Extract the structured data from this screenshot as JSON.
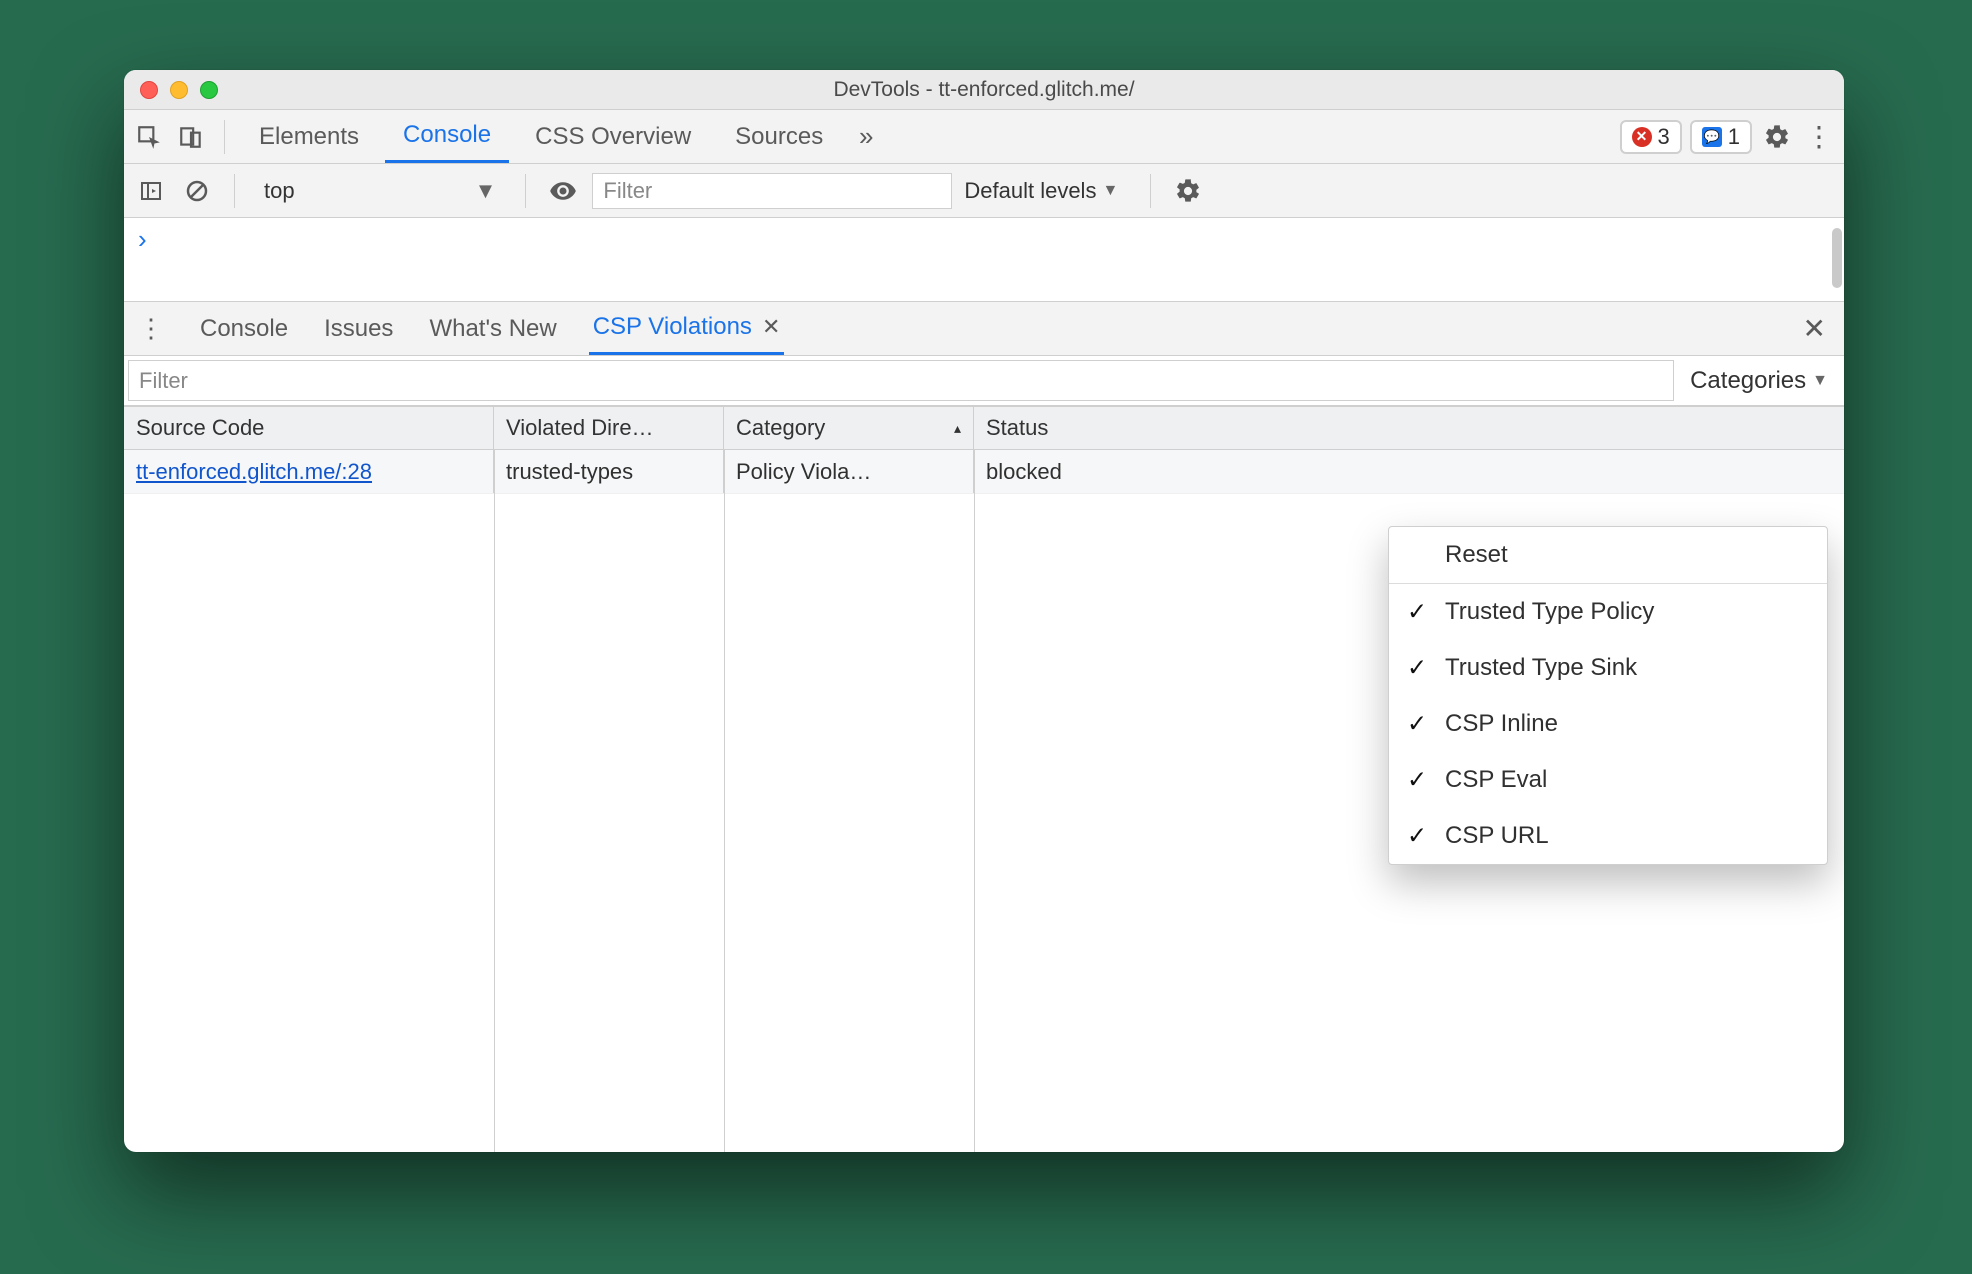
{
  "window": {
    "title": "DevTools - tt-enforced.glitch.me/"
  },
  "mainTabs": {
    "items": [
      "Elements",
      "Console",
      "CSS Overview",
      "Sources"
    ],
    "activeIndex": 1,
    "errorCount": "3",
    "issueCount": "1"
  },
  "consoleBar": {
    "context": "top",
    "filterPlaceholder": "Filter",
    "levels": "Default levels"
  },
  "drawer": {
    "tabs": [
      "Console",
      "Issues",
      "What's New",
      "CSP Violations"
    ],
    "activeIndex": 3,
    "filterPlaceholder": "Filter",
    "categoriesLabel": "Categories"
  },
  "table": {
    "headers": {
      "source": "Source Code",
      "directive": "Violated Dire…",
      "category": "Category",
      "status": "Status"
    },
    "row": {
      "source": "tt-enforced.glitch.me/:28",
      "directive": "trusted-types",
      "category": "Policy Viola…",
      "status": "blocked"
    }
  },
  "dropdown": {
    "reset": "Reset",
    "options": [
      "Trusted Type Policy",
      "Trusted Type Sink",
      "CSP Inline",
      "CSP Eval",
      "CSP URL"
    ]
  }
}
